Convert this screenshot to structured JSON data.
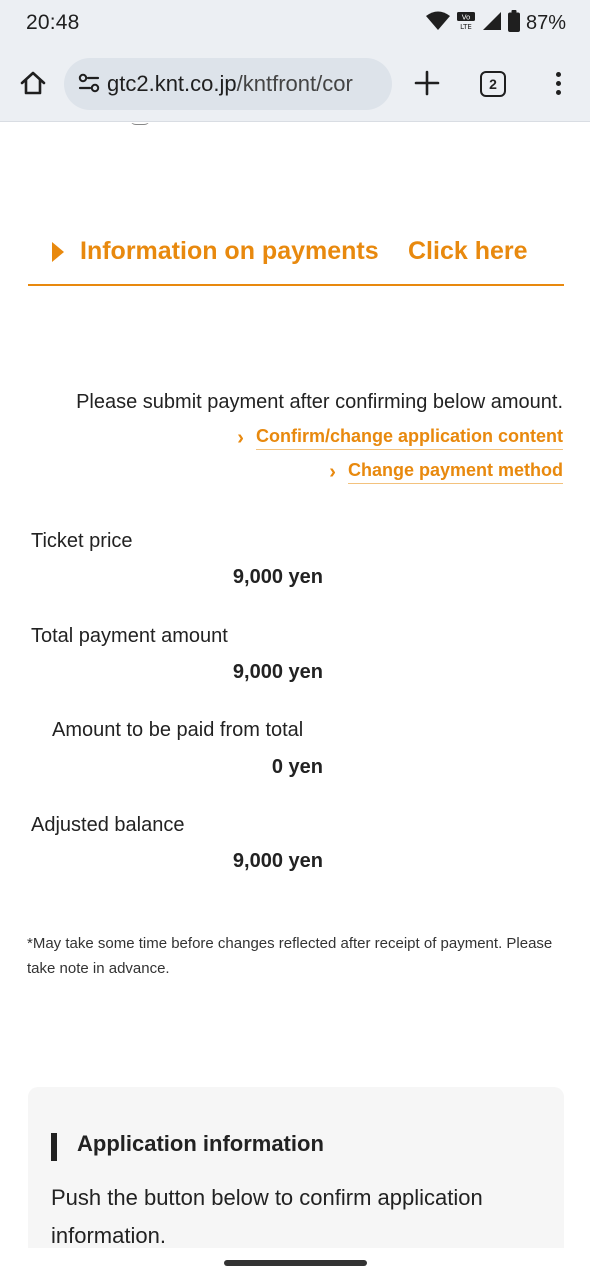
{
  "status_bar": {
    "time": "20:48",
    "battery": "87%",
    "icons": [
      "wifi-icon",
      "volte-icon",
      "signal-icon",
      "battery-icon"
    ]
  },
  "browser": {
    "url_host": "gtc2.knt.co.jp",
    "url_path": "/kntfront/cor",
    "tab_count": "2",
    "icons": [
      "home-icon",
      "site-settings-icon",
      "plus-icon",
      "more-vert-icon"
    ]
  },
  "page": {
    "info_link": {
      "label": "Information on payments",
      "action": "Click here"
    },
    "instruction": "Please submit payment after confirming below amount.",
    "links": {
      "confirm_change": "Confirm/change application content",
      "change_payment": "Change payment method"
    },
    "payments": [
      {
        "label": "Ticket price",
        "value": "9,000 yen"
      },
      {
        "label": "Total payment amount",
        "value": "9,000 yen"
      },
      {
        "label": "Amount to be paid from total",
        "value": "0 yen"
      },
      {
        "label": "Adjusted balance",
        "value": "9,000 yen"
      }
    ],
    "note": "*May take some time before changes reflected after receipt of payment. Please take note in advance.",
    "application": {
      "title": "Application information",
      "description": "Push the button below to confirm application information."
    }
  },
  "colors": {
    "accent": "#e8890e",
    "accent_underline": "#f3c27d",
    "chrome_bg": "#eceff3",
    "url_pill": "#dde3ea",
    "box_bg": "#f6f6f6"
  }
}
